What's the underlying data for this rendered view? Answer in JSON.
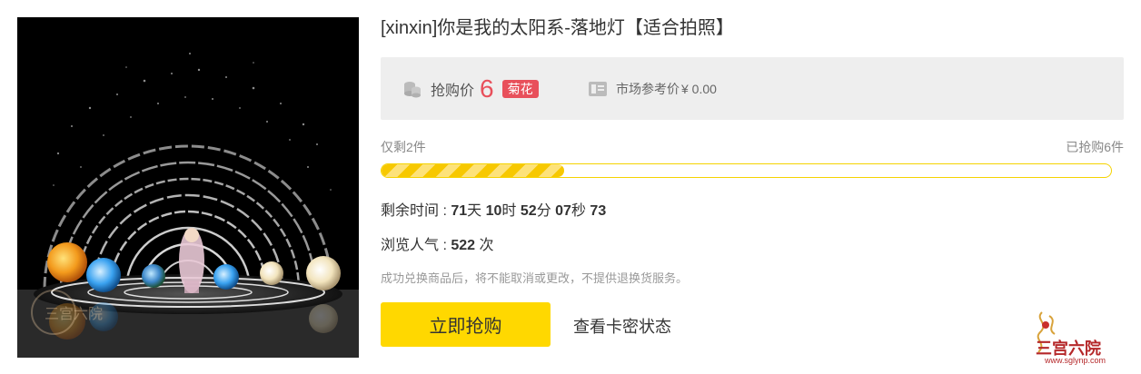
{
  "product": {
    "title": "[xinxin]你是我的太阳系-落地灯【适合拍照】",
    "image_icon": "solar-system-floor-lamp-photo"
  },
  "price": {
    "label": "抢购价",
    "value": "6",
    "currency": "菊花",
    "market_label": "市场参考价",
    "market_value": "¥ 0.00",
    "accent_color": "#e8505b"
  },
  "stock": {
    "remaining": "仅剩2件",
    "sold": "已抢购6件",
    "progress_fraction": 0.25,
    "bar_color": "#f7c800"
  },
  "countdown": {
    "label": "剩余时间 :",
    "days": "71",
    "days_unit": "天",
    "hours": "10",
    "hours_unit": "时",
    "minutes": "52",
    "minutes_unit": "分",
    "seconds": "07",
    "seconds_unit": "秒",
    "tick": "73"
  },
  "views": {
    "label": "浏览人气 :",
    "count": "522",
    "unit": "次"
  },
  "notice": "成功兑换商品后，将不能取消或更改，不提供退换货服务。",
  "actions": {
    "buy_label": "立即抢购",
    "status_label": "查看卡密状态",
    "buy_color": "#ffd800"
  },
  "watermark": {
    "name": "三宫六院",
    "url": "www.sglynp.com",
    "image_text": "三宫六院"
  }
}
